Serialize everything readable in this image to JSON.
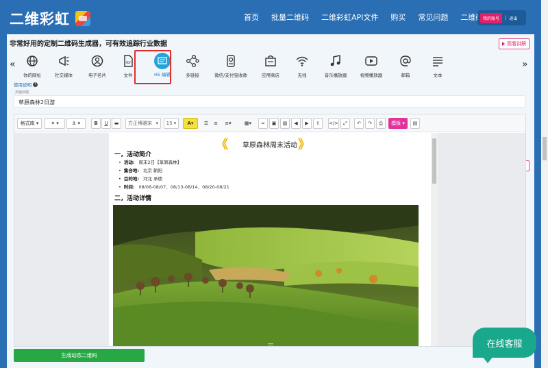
{
  "app": {
    "logo_text": "二维彩虹",
    "nav": [
      "首页",
      "批量二维码",
      "二维彩虹API文件",
      "购买",
      "常见问题",
      "二维码学院"
    ],
    "account": {
      "my_account": "我的账号",
      "separator": "|",
      "logout": "退出"
    }
  },
  "tagline": "非常好用的定制二维码生成器，可有效追踪行业数据",
  "watch_label": "观看讲解",
  "tabs": [
    {
      "label": "你的网址",
      "icon": "globe-icon"
    },
    {
      "label": "社交媒体",
      "icon": "megaphone-icon"
    },
    {
      "label": "电子名片",
      "icon": "user-card-icon"
    },
    {
      "label": "文件",
      "icon": "file-icon"
    },
    {
      "label": "H5 编辑",
      "icon": "h5-editor-icon"
    },
    {
      "label": "多链接",
      "icon": "share-links-icon"
    },
    {
      "label": "微信/支付宝收款",
      "icon": "payment-icon"
    },
    {
      "label": "应用商店",
      "icon": "store-icon"
    },
    {
      "label": "无线",
      "icon": "wifi-icon"
    },
    {
      "label": "音乐播放器",
      "icon": "music-icon"
    },
    {
      "label": "视频播放器",
      "icon": "video-icon"
    },
    {
      "label": "邮箱",
      "icon": "at-icon"
    },
    {
      "label": "文本",
      "icon": "text-icon"
    }
  ],
  "active_tab": "H5 编辑",
  "help_label": "使用说明",
  "field_label": "页面标题",
  "page_title_value": "草原森林2日游",
  "toolbar": {
    "style_library": "格式库",
    "font_family": "方正博雅宋",
    "font_size": "15",
    "template": "模板"
  },
  "doc": {
    "title": "草原森林周末活动",
    "chev_left": "《",
    "chev_right": "》",
    "section1": "一，活动简介",
    "items": [
      {
        "label": "活动:",
        "value": "周末2日【草原森林】"
      },
      {
        "label": "集合地:",
        "value": "北京 朝阳"
      },
      {
        "label": "目的地:",
        "value": "河北 承德"
      },
      {
        "label": "时间:",
        "value": "08/06-08/07、08/13-08/14、08/20-08/21"
      }
    ],
    "section2": "二，活动详情"
  },
  "cta_label": "生成动态二维码",
  "service_label": "在线客服",
  "colors": {
    "brand": "#2a6eb4",
    "accent": "#e11f6b",
    "cta": "#28a745",
    "active_tab": "#24a3d9"
  }
}
